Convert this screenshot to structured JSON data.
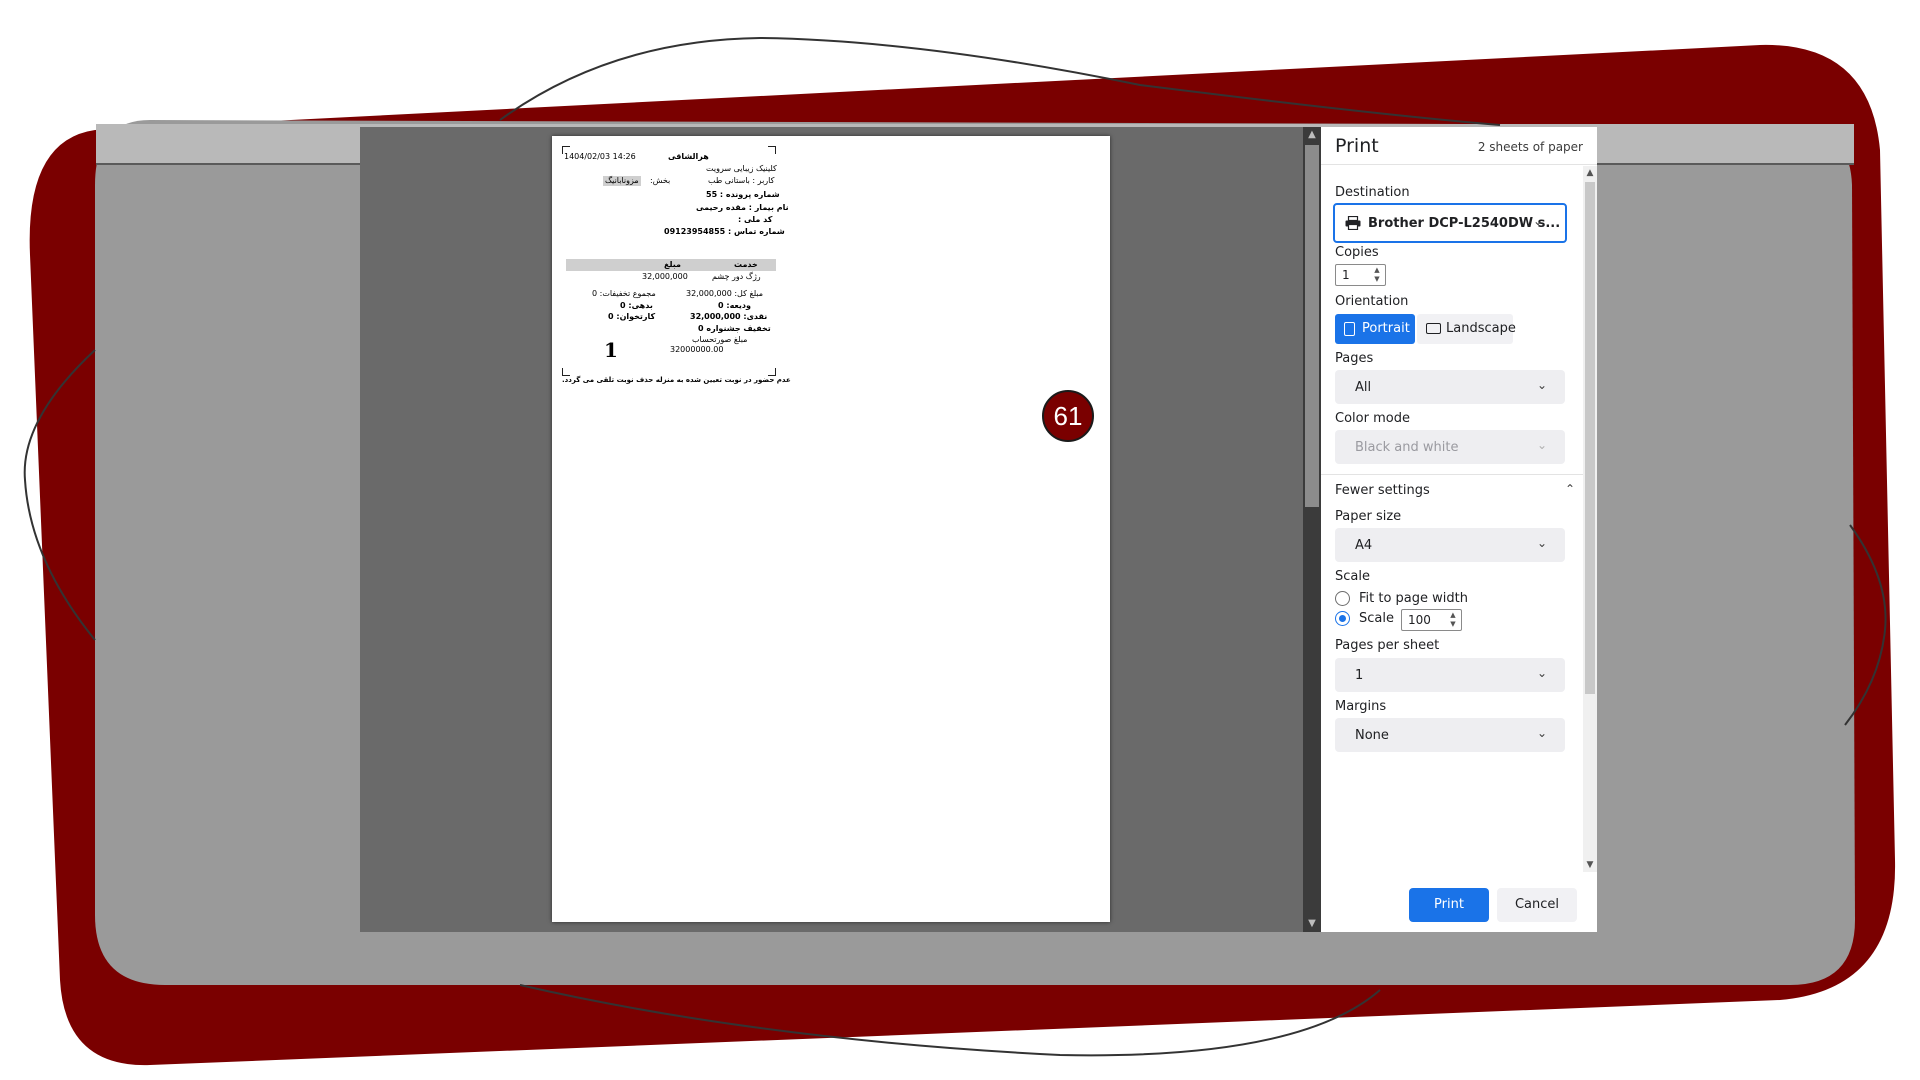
{
  "preview": {
    "step_badge": "61",
    "receipt": {
      "datetime": "1404/02/03  14:26",
      "header_title": "هرالشاقی",
      "clinic_name": "کلینیک زیبایی سرویت",
      "user_line": "کاربر : باستانی طب",
      "section_label": "بخش:",
      "section_tag": "مزونابانیگ",
      "file_number": "شماره پرونده : 55",
      "patient_name": "نام بیمار : مقده رحیمی",
      "national_id": "کد ملی :",
      "phone": "شماره تماس : 09123954855",
      "col_service": "خدمت",
      "col_amount": "مبلغ",
      "service_name": "رژگ دور چشم",
      "service_amount": "32,000,000",
      "total_amount": "مبلغ کل: 32,000,000",
      "total_discounts": "مجموع تخفیفات: 0",
      "deposit": "ودیعه: 0",
      "debt": "بدهی: 0",
      "cash": "نقدی: 32,000,000",
      "card_reader": "کارتخوان: 0",
      "festival_discount": "تخفیف جشنواره 0",
      "queue_number": "1",
      "invoice_label": "مبلغ صورتحساب",
      "invoice_amount": "32000000.00",
      "footer_note": "عدم حضور در نوبت تعیین شده به منزله حذف نوبت تلقی می گردد."
    }
  },
  "panel": {
    "title": "Print",
    "sheets": "2 sheets of paper",
    "destination_label": "Destination",
    "destination_value": "Brother DCP-L2540DW s...",
    "copies_label": "Copies",
    "copies_value": "1",
    "orientation_label": "Orientation",
    "orientation_portrait": "Portrait",
    "orientation_landscape": "Landscape",
    "pages_label": "Pages",
    "pages_value": "All",
    "color_mode_label": "Color mode",
    "color_mode_value": "Black and white",
    "fewer_settings": "Fewer settings",
    "paper_size_label": "Paper size",
    "paper_size_value": "A4",
    "scale_label": "Scale",
    "scale_fit_option": "Fit to page width",
    "scale_custom_option": "Scale",
    "scale_value": "100",
    "pages_per_sheet_label": "Pages per sheet",
    "pages_per_sheet_value": "1",
    "margins_label": "Margins",
    "margins_value": "None",
    "print_button": "Print",
    "cancel_button": "Cancel"
  },
  "colors": {
    "frame_red": "#7a0000",
    "accent_blue": "#1a73e8",
    "preview_gray": "#6a6a6a"
  },
  "icons": [
    "printer-icon",
    "chevron-down-icon",
    "chevron-up-icon",
    "portrait-icon",
    "landscape-icon"
  ]
}
